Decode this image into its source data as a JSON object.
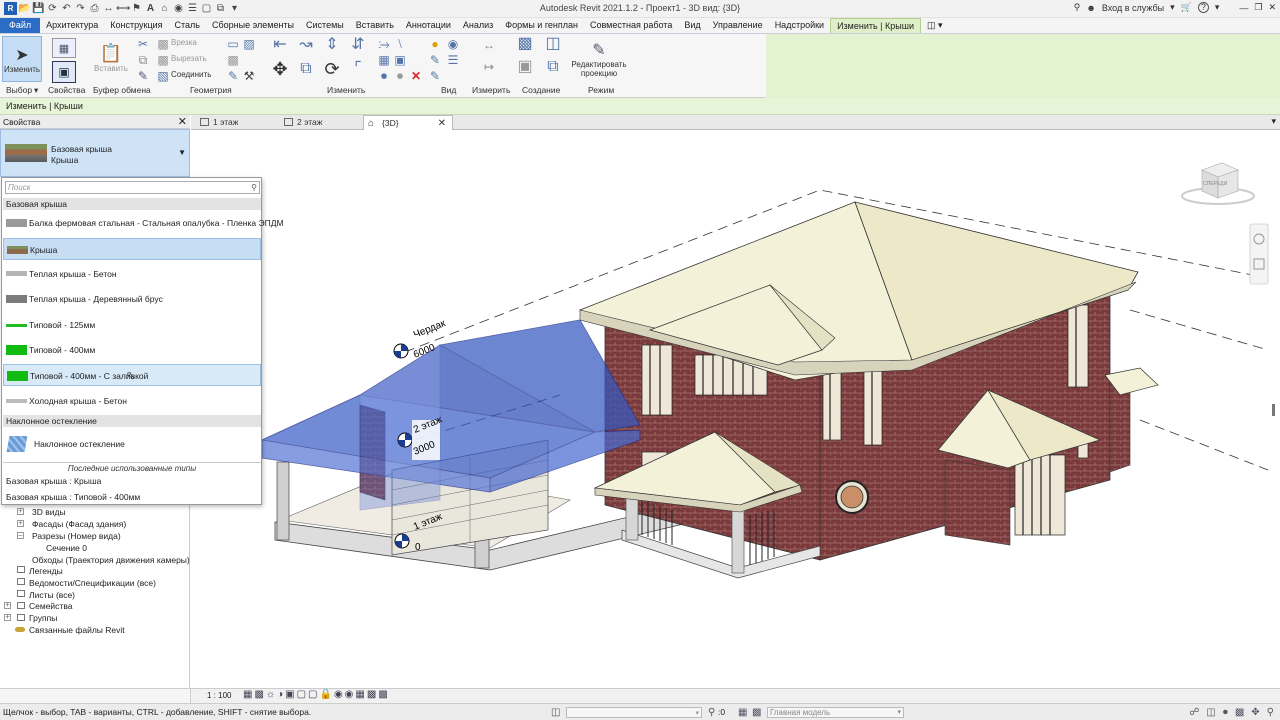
{
  "window": {
    "title": "Autodesk Revit 2021.1.2 - Проект1 - 3D вид: {3D}",
    "sign_in": "Вход в службы",
    "help": "?"
  },
  "ribbon_tabs": [
    "Файл",
    "Архитектура",
    "Конструкция",
    "Сталь",
    "Сборные элементы",
    "Системы",
    "Вставить",
    "Аннотации",
    "Анализ",
    "Формы и генплан",
    "Совместная работа",
    "Вид",
    "Управление",
    "Надстройки",
    "Изменить | Крыши"
  ],
  "ribbon": {
    "modify_label": "Изменить",
    "paste_label": "Вставить",
    "cut_label": "Врезка",
    "cut2_label": "Вырезать",
    "join_label": "Соединить",
    "edit_footprint_label": "Редактировать проекцию",
    "panels": [
      "Выбор",
      "Свойства",
      "Буфер обмена",
      "Геометрия",
      "Изменить",
      "Вид",
      "Измерить",
      "Создание",
      "Режим"
    ]
  },
  "options_bar": {
    "text": "Изменить | Крыши"
  },
  "properties": {
    "header": "Свойства",
    "family": "Базовая крыша",
    "type": "Крыша"
  },
  "dropdown": {
    "search_placeholder": "Поиск",
    "group1": "Базовая крыша",
    "items": [
      {
        "label": "Балка фермовая стальная - Стальная опалубка - Пленка ЭПДМ",
        "swatch": "#9a9a9a"
      },
      {
        "label": "Крыша",
        "swatch": "#8b7355"
      },
      {
        "label": "Теплая крыша - Бетон",
        "swatch": "#b5b5b5"
      },
      {
        "label": "Теплая крыша - Деревянный брус",
        "swatch": "#7b7b7b"
      },
      {
        "label": "Типовой - 125мм",
        "swatch": "#22bb22"
      },
      {
        "label": "Типовой - 400мм",
        "swatch": "#11bb11"
      },
      {
        "label": "Типовой - 400мм - С заливкой",
        "swatch": "#11bb11"
      },
      {
        "label": "Холодная крыша - Бетон",
        "swatch": "#bbbbbb"
      }
    ],
    "group2": "Наклонное остекление",
    "glazing_item": "Наклонное остекление",
    "recent_label": "Последние использованные типы",
    "recent": [
      "Базовая крыша : Крыша",
      "Базовая крыша : Типовой - 400мм"
    ]
  },
  "tree": [
    "3D виды",
    "Фасады (Фасад здания)",
    "Разрезы (Номер вида)",
    "Сечение 0",
    "Обходы (Траектория движения камеры)",
    "Легенды",
    "Ведомости/Спецификации (все)",
    "Листы (все)",
    "Семейства",
    "Группы",
    "Связанные файлы Revit"
  ],
  "view_tabs": [
    "1 этаж",
    "2 этаж",
    "{3D}"
  ],
  "levels": [
    {
      "name": "Чердак",
      "elev": "6000"
    },
    {
      "name": "2 этаж",
      "elev": "3000"
    },
    {
      "name": "1 этаж",
      "elev": "0"
    }
  ],
  "viewcube_label": "СПЕРЕДИ",
  "view_control": {
    "scale": "1 : 100"
  },
  "status": {
    "hint": "Щелчок - выбор, TAB - варианты, CTRL - добавление, SHIFT - снятие выбора.",
    "zero": ":0",
    "model": "Главная модель"
  }
}
